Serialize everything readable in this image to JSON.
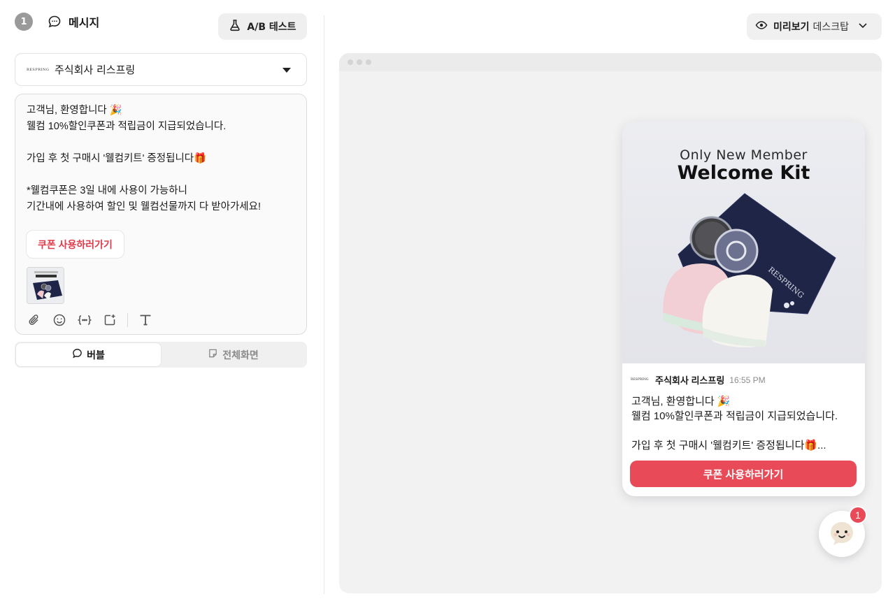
{
  "header": {
    "step_number": "1",
    "title": "메시지",
    "ab_test_label": "A/B 테스트"
  },
  "sender": {
    "logo_text": "RESPRING",
    "name": "주식회사 리스프링"
  },
  "editor": {
    "body": "고객님, 환영합니다 🎉\n웰컴 10%할인쿠폰과 적립금이 지급되었습니다.\n\n가입 후 첫 구매시 '웰컴키트' 증정됩니다🎁\n\n*웰컴쿠폰은 3일 내에 사용이 가능하니\n기간내에 사용하여 할인 및 웰컴선물까지 다 받아가세요!",
    "button_label": "쿠폰 사용하러가기",
    "toolbar_icons": [
      "paperclip-icon",
      "emoji-icon",
      "variable-icon",
      "add-image-icon",
      "text-format-icon"
    ]
  },
  "tabs": [
    {
      "label": "버블",
      "icon": "bubble-icon",
      "active": true
    },
    {
      "label": "전체화면",
      "icon": "fullscreen-note-icon",
      "active": false
    }
  ],
  "preview": {
    "label": "미리보기",
    "device": "데스크탑"
  },
  "card": {
    "image_subtitle": "Only New Member",
    "image_title": "Welcome Kit",
    "sender_logo_text": "RESPRING",
    "sender_name": "주식회사 리스프링",
    "time": "16:55 PM",
    "text": "고객님, 환영합니다 🎉\n웰컴 10%할인쿠폰과 적립금이 지급되었습니다.\n\n가입 후 첫 구매시 '웰컴키트' 증정됩니다🎁...",
    "cta_label": "쿠폰 사용하러가기",
    "accent_color": "#e84a57"
  },
  "launcher": {
    "badge_count": "1"
  }
}
